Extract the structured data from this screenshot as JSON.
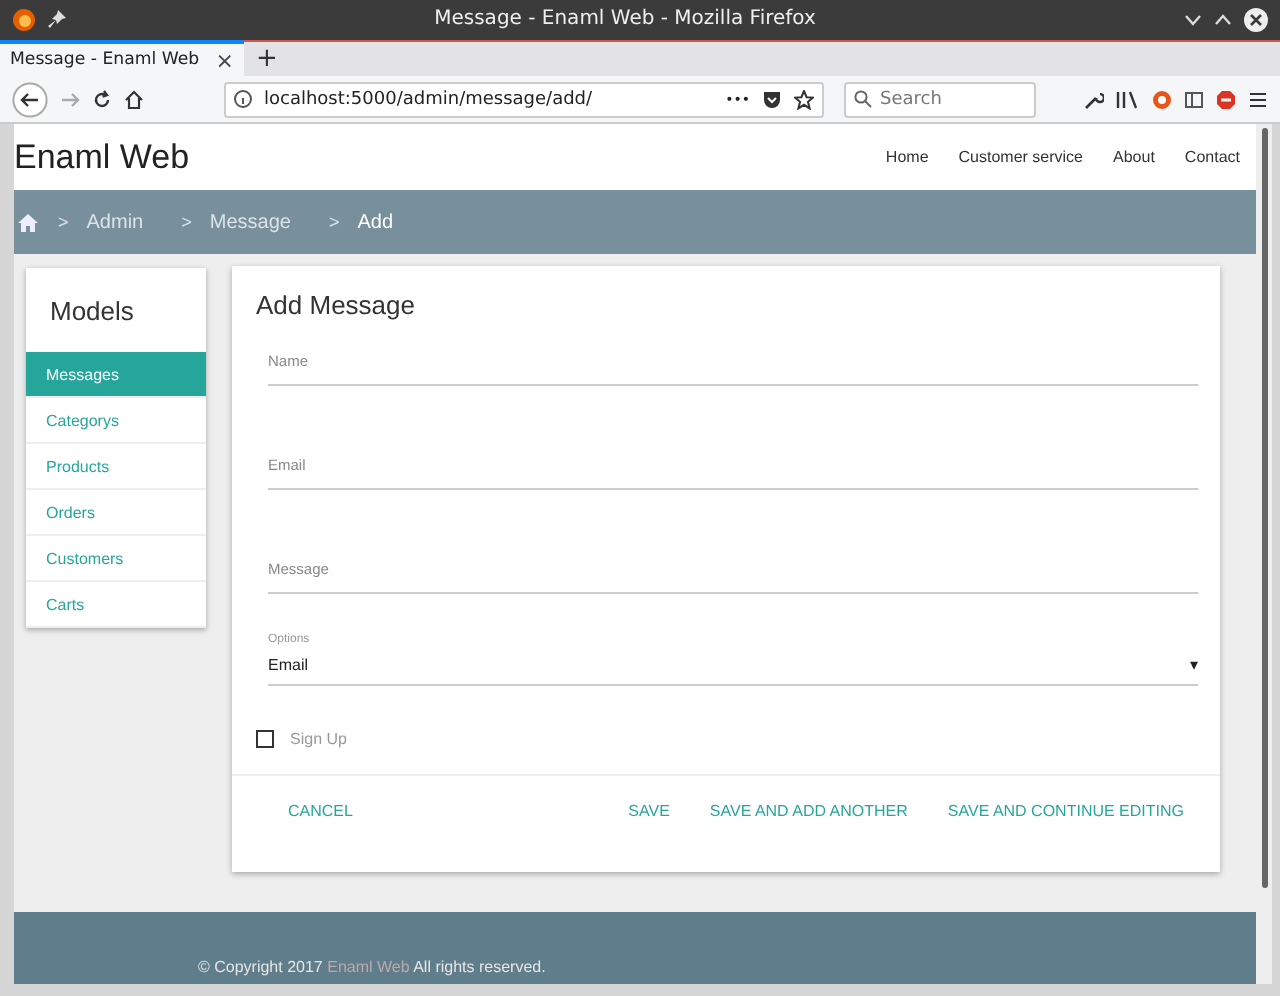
{
  "window": {
    "title": "Message - Enaml Web - Mozilla Firefox"
  },
  "tabs": [
    {
      "label": "Message - Enaml Web",
      "selected": true,
      "close": "×"
    }
  ],
  "new_tab": "+",
  "address_bar": {
    "url": "localhost:5000/admin/message/add/",
    "more": "•••"
  },
  "search": {
    "placeholder": "Search"
  },
  "site": {
    "brand": "Enaml Web",
    "nav": [
      "Home",
      "Customer service",
      "About",
      "Contact"
    ]
  },
  "breadcrumb": [
    {
      "label": "Admin",
      "current": false
    },
    {
      "label": "Message",
      "current": false
    },
    {
      "label": "Add",
      "current": true
    }
  ],
  "breadcrumb_separator": ">",
  "sidebar": {
    "title": "Models",
    "items": [
      {
        "label": "Messages",
        "selected": true
      },
      {
        "label": "Categorys",
        "selected": false
      },
      {
        "label": "Products",
        "selected": false
      },
      {
        "label": "Orders",
        "selected": false
      },
      {
        "label": "Customers",
        "selected": false
      },
      {
        "label": "Carts",
        "selected": false
      }
    ]
  },
  "form": {
    "title": "Add Message",
    "fields": [
      {
        "kind": "text",
        "placeholder": "Name"
      },
      {
        "kind": "text",
        "placeholder": "Email"
      },
      {
        "kind": "text",
        "placeholder": "Message"
      },
      {
        "kind": "select",
        "label": "Options",
        "value": "Email",
        "caret": "▾"
      },
      {
        "kind": "checkbox",
        "label": "Sign Up",
        "checked": false
      }
    ],
    "buttons": [
      {
        "label": "CANCEL",
        "kind": "left"
      },
      {
        "label": "SAVE",
        "kind": "right"
      },
      {
        "label": "SAVE AND ADD ANOTHER",
        "kind": "right"
      },
      {
        "label": "SAVE AND CONTINUE EDITING",
        "kind": "right"
      }
    ]
  },
  "footer": {
    "prefix": "© Copyright 2017",
    "link": "Enaml Web",
    "suffix": "All rights reserved."
  }
}
